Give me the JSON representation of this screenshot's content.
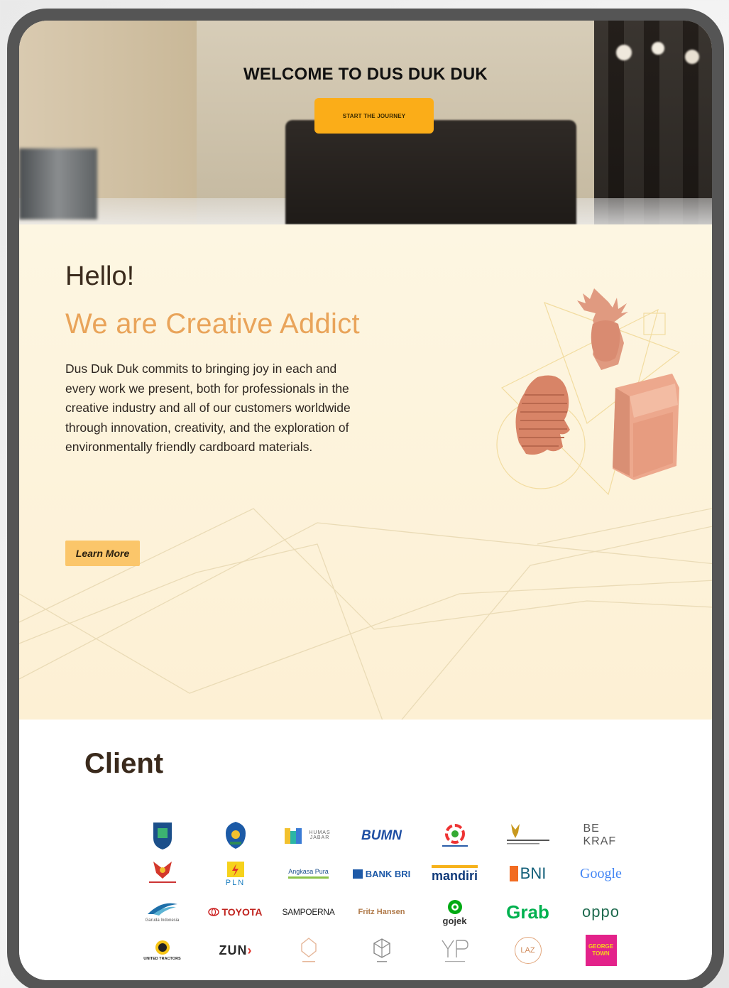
{
  "hero": {
    "title": "WELCOME TO DUS DUK DUK",
    "cta_label": "START THE JOURNEY"
  },
  "about": {
    "greeting": "Hello!",
    "tagline": "We are Creative Addict",
    "description": "Dus Duk Duk commits to bringing joy in each and every work we present, both for professionals in the creative industry and all of our customers worldwide through innovation, creativity, and the exploration of environmentally friendly cardboard materials.",
    "learn_more_label": "Learn More"
  },
  "client": {
    "title": "Client",
    "logos": [
      {
        "text": "",
        "name": "surabaya-crest-logo"
      },
      {
        "text": "",
        "name": "jatim-crest-logo"
      },
      {
        "text": "HUMAS JABAR",
        "name": "humas-jabar-logo"
      },
      {
        "text": "BUMN",
        "name": "bumn-logo"
      },
      {
        "text": "",
        "name": "kemenparekraf-logo"
      },
      {
        "text": "",
        "name": "garuda-ministry-logo"
      },
      {
        "text": "BE KRAF",
        "name": "bekraf-logo"
      },
      {
        "text": "",
        "name": "kota-crest-logo"
      },
      {
        "text": "PLN",
        "name": "pln-logo"
      },
      {
        "text": "Angkasa Pura",
        "name": "angkasa-pura-logo"
      },
      {
        "text": "BANK BRI",
        "name": "bank-bri-logo"
      },
      {
        "text": "mandiri",
        "name": "mandiri-logo"
      },
      {
        "text": "BNI",
        "name": "bni-logo"
      },
      {
        "text": "Google",
        "name": "google-logo"
      },
      {
        "text": "Garuda Indonesia",
        "name": "garuda-indonesia-logo"
      },
      {
        "text": "TOYOTA",
        "name": "toyota-logo"
      },
      {
        "text": "SAMPOERNA",
        "name": "sampoerna-logo"
      },
      {
        "text": "Fritz Hansen",
        "name": "fritz-hansen-logo"
      },
      {
        "text": "gojek",
        "name": "gojek-logo"
      },
      {
        "text": "Grab",
        "name": "grab-logo"
      },
      {
        "text": "oppo",
        "name": "oppo-logo"
      },
      {
        "text": "UNITED TRACTORS",
        "name": "united-tractors-logo"
      },
      {
        "text": "ZUN",
        "name": "zun-logo"
      },
      {
        "text": "",
        "name": "rumah-logo"
      },
      {
        "text": "",
        "name": "cube-logo"
      },
      {
        "text": "",
        "name": "ypt-logo"
      },
      {
        "text": "LAZ",
        "name": "laz-logo"
      },
      {
        "text": "GEORGE TOWN",
        "name": "george-town-logo"
      }
    ]
  },
  "colors": {
    "accent": "#fbad18",
    "tagline": "#e9a45a",
    "about_bg": "#fdf6e2",
    "frame": "#555555"
  }
}
